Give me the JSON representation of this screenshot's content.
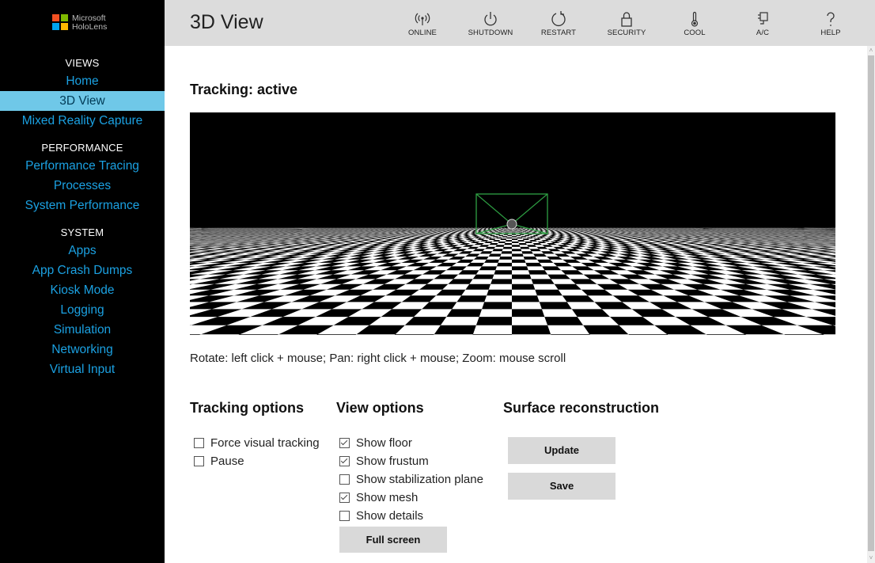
{
  "logo": {
    "line1": "Microsoft",
    "line2": "HoloLens",
    "colors": [
      "#f25022",
      "#7fba00",
      "#00a4ef",
      "#ffb900"
    ]
  },
  "sidebar": {
    "sections": [
      {
        "title": "VIEWS",
        "items": [
          {
            "label": "Home"
          },
          {
            "label": "3D View",
            "active": true
          },
          {
            "label": "Mixed Reality Capture"
          }
        ]
      },
      {
        "title": "PERFORMANCE",
        "items": [
          {
            "label": "Performance Tracing"
          },
          {
            "label": "Processes"
          },
          {
            "label": "System Performance"
          }
        ]
      },
      {
        "title": "SYSTEM",
        "items": [
          {
            "label": "Apps"
          },
          {
            "label": "App Crash Dumps"
          },
          {
            "label": "Kiosk Mode"
          },
          {
            "label": "Logging"
          },
          {
            "label": "Simulation"
          },
          {
            "label": "Networking"
          },
          {
            "label": "Virtual Input"
          }
        ]
      }
    ]
  },
  "header": {
    "title": "3D View",
    "buttons": [
      {
        "label": "ONLINE",
        "icon": "wireless-icon"
      },
      {
        "label": "SHUTDOWN",
        "icon": "power-icon"
      },
      {
        "label": "RESTART",
        "icon": "restart-icon"
      },
      {
        "label": "SECURITY",
        "icon": "lock-icon"
      },
      {
        "label": "COOL",
        "icon": "thermometer-icon"
      },
      {
        "label": "A/C",
        "icon": "plug-icon"
      },
      {
        "label": "HELP",
        "icon": "help-icon"
      }
    ]
  },
  "main": {
    "tracking_status": "Tracking: active",
    "hint": "Rotate: left click + mouse; Pan: right click + mouse; Zoom: mouse scroll",
    "tracking_options": {
      "title": "Tracking options",
      "items": [
        {
          "label": "Force visual tracking",
          "checked": false
        },
        {
          "label": "Pause",
          "checked": false
        }
      ]
    },
    "view_options": {
      "title": "View options",
      "items": [
        {
          "label": "Show floor",
          "checked": true
        },
        {
          "label": "Show frustum",
          "checked": true
        },
        {
          "label": "Show stabilization plane",
          "checked": false
        },
        {
          "label": "Show mesh",
          "checked": true
        },
        {
          "label": "Show details",
          "checked": false
        }
      ],
      "fullscreen_label": "Full screen"
    },
    "surface": {
      "title": "Surface reconstruction",
      "update_label": "Update",
      "save_label": "Save"
    }
  },
  "colors": {
    "accent": "#1ba1e2",
    "active_bg": "#6fc8e8",
    "frustum": "#2ea043"
  }
}
